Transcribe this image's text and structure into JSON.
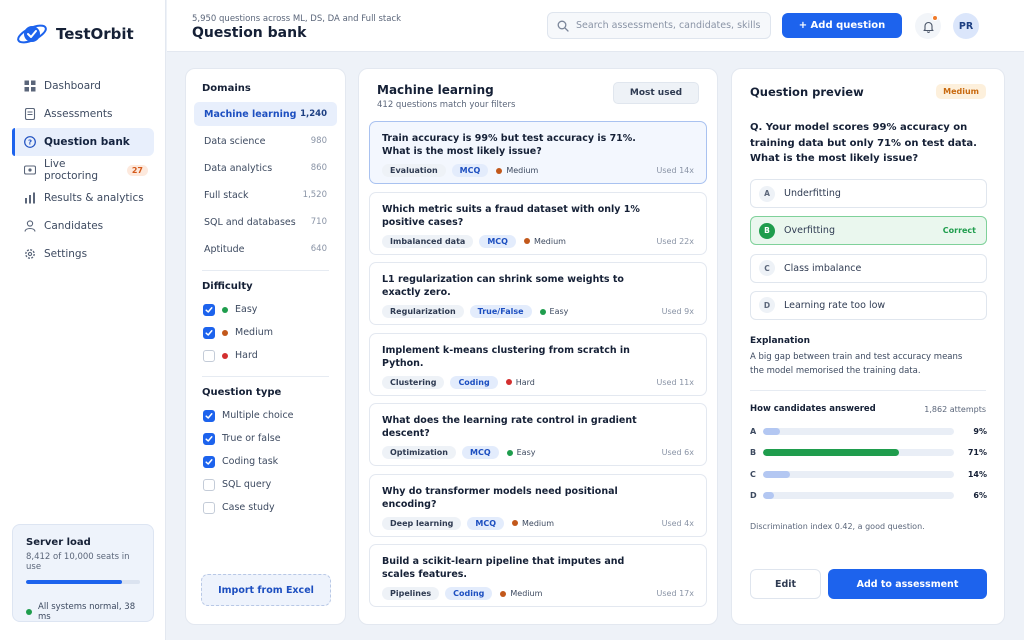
{
  "brand": {
    "name": "TestOrbit",
    "logo_icon": "orbit-check-logo"
  },
  "sidebar": {
    "items": [
      {
        "label": "Dashboard",
        "icon": "grid-icon"
      },
      {
        "label": "Assessments",
        "icon": "document-icon"
      },
      {
        "label": "Question bank",
        "icon": "question-circle-icon",
        "active": true
      },
      {
        "label": "Live proctoring",
        "icon": "video-icon",
        "badge": "27"
      },
      {
        "label": "Results & analytics",
        "icon": "bar-chart-icon"
      },
      {
        "label": "Candidates",
        "icon": "user-icon"
      },
      {
        "label": "Settings",
        "icon": "gear-icon"
      }
    ],
    "server": {
      "title": "Server load",
      "usage": "8,412 of 10,000 seats in use",
      "fill_fraction": 0.8412,
      "status": "All systems normal, 38 ms",
      "status_color": "#1f9d4d"
    }
  },
  "header": {
    "subtitle": "5,950 questions across ML, DS, DA and Full stack",
    "title": "Question bank",
    "search_placeholder": "Search assessments, candidates, skills",
    "add_label": "+ Add question",
    "avatar_initials": "PR",
    "accent": "#1d63ed"
  },
  "filters": {
    "domains_heading": "Domains",
    "domains": [
      {
        "label": "Machine learning",
        "count": "1,240",
        "active": true
      },
      {
        "label": "Data science",
        "count": "980"
      },
      {
        "label": "Data analytics",
        "count": "860"
      },
      {
        "label": "Full stack",
        "count": "1,520"
      },
      {
        "label": "SQL and databases",
        "count": "710"
      },
      {
        "label": "Aptitude",
        "count": "640"
      }
    ],
    "difficulty_heading": "Difficulty",
    "difficulty": [
      {
        "label": "Easy",
        "checked": true,
        "color": "#1f9d4d"
      },
      {
        "label": "Medium",
        "checked": true,
        "color": "#c2581b"
      },
      {
        "label": "Hard",
        "checked": false,
        "color": "#d32f2f"
      }
    ],
    "type_heading": "Question type",
    "types": [
      {
        "label": "Multiple choice",
        "checked": true
      },
      {
        "label": "True or false",
        "checked": true
      },
      {
        "label": "Coding task",
        "checked": true
      },
      {
        "label": "SQL query",
        "checked": false
      },
      {
        "label": "Case study",
        "checked": false
      }
    ],
    "import_label": "Import from Excel"
  },
  "list": {
    "title": "Machine learning",
    "subtitle": "412 questions match your filters",
    "sort_label": "Most used",
    "questions": [
      {
        "text": "Train accuracy is 99% but test accuracy is 71%. What is the most likely issue?",
        "topic": "Evaluation",
        "type": "MCQ",
        "difficulty": "Medium",
        "diff_color": "#c2581b",
        "used": "Used 14x",
        "selected": true
      },
      {
        "text": "Which metric suits a fraud dataset with only 1% positive cases?",
        "topic": "Imbalanced data",
        "type": "MCQ",
        "difficulty": "Medium",
        "diff_color": "#c2581b",
        "used": "Used 22x"
      },
      {
        "text": "L1 regularization can shrink some weights to exactly zero.",
        "topic": "Regularization",
        "type": "True/False",
        "difficulty": "Easy",
        "diff_color": "#1f9d4d",
        "used": "Used 9x"
      },
      {
        "text": "Implement k-means clustering from scratch in Python.",
        "topic": "Clustering",
        "type": "Coding",
        "difficulty": "Hard",
        "diff_color": "#d32f2f",
        "used": "Used 11x"
      },
      {
        "text": "What does the learning rate control in gradient descent?",
        "topic": "Optimization",
        "type": "MCQ",
        "difficulty": "Easy",
        "diff_color": "#1f9d4d",
        "used": "Used 6x"
      },
      {
        "text": "Why do transformer models need positional encoding?",
        "topic": "Deep learning",
        "type": "MCQ",
        "difficulty": "Medium",
        "diff_color": "#c2581b",
        "used": "Used 4x"
      },
      {
        "text": "Build a scikit-learn pipeline that imputes and scales features.",
        "topic": "Pipelines",
        "type": "Coding",
        "difficulty": "Medium",
        "diff_color": "#c2581b",
        "used": "Used 17x"
      }
    ]
  },
  "preview": {
    "title": "Question preview",
    "difficulty_badge": "Medium",
    "question": "Q. Your model scores 99% accuracy on training data but only 71% on test data. What is the most likely issue?",
    "options": [
      {
        "letter": "A",
        "label": "Underfitting"
      },
      {
        "letter": "B",
        "label": "Overfitting",
        "correct": true
      },
      {
        "letter": "C",
        "label": "Class imbalance"
      },
      {
        "letter": "D",
        "label": "Learning rate too low"
      }
    ],
    "correct_label": "Correct",
    "explanation_heading": "Explanation",
    "explanation": "A big gap between train and test accuracy means the model memorised the training data.",
    "answers_heading": "How candidates answered",
    "attempts": "1,862 attempts",
    "answers": [
      {
        "letter": "A",
        "percent": 9,
        "label": "9%"
      },
      {
        "letter": "B",
        "percent": 71,
        "label": "71%",
        "correct": true
      },
      {
        "letter": "C",
        "percent": 14,
        "label": "14%"
      },
      {
        "letter": "D",
        "percent": 6,
        "label": "6%"
      }
    ],
    "note": "Discrimination index 0.42, a good question.",
    "edit_label": "Edit",
    "add_label": "Add to assessment"
  }
}
